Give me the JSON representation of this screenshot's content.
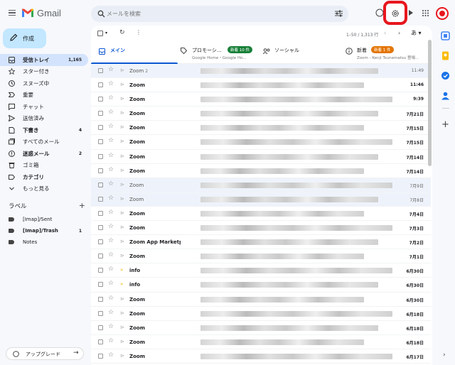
{
  "header": {
    "app": "Gmail",
    "search_placeholder": "メールを検索"
  },
  "compose": {
    "label": "作成"
  },
  "nav": [
    {
      "label": "受信トレイ",
      "count": "1,165",
      "active": true,
      "bold": true,
      "icon": "inbox-icon"
    },
    {
      "label": "スター付き",
      "count": "",
      "icon": "star-icon"
    },
    {
      "label": "スヌーズ中",
      "count": "",
      "icon": "clock-icon"
    },
    {
      "label": "重要",
      "count": "",
      "icon": "important-icon"
    },
    {
      "label": "チャット",
      "count": "",
      "icon": "chat-icon"
    },
    {
      "label": "送信済み",
      "count": "",
      "icon": "send-icon"
    },
    {
      "label": "下書き",
      "count": "4",
      "bold": true,
      "icon": "draft-icon"
    },
    {
      "label": "すべてのメール",
      "count": "",
      "icon": "all-mail-icon"
    },
    {
      "label": "迷惑メール",
      "count": "2",
      "bold": true,
      "icon": "spam-icon"
    },
    {
      "label": "ゴミ箱",
      "count": "",
      "icon": "trash-icon"
    },
    {
      "label": "カテゴリ",
      "count": "",
      "bold": true,
      "icon": "category-icon"
    },
    {
      "label": "もっと見る",
      "count": "",
      "icon": "chevron-down-icon"
    }
  ],
  "labels_title": "ラベル",
  "labels": [
    {
      "label": "[Imap]/Sent",
      "count": ""
    },
    {
      "label": "[Imap]/Trash",
      "count": "1",
      "bold": true
    },
    {
      "label": "Notes",
      "count": ""
    }
  ],
  "upgrade": "アップグレード",
  "toolbar": {
    "range": "1–50 / 1,313 行",
    "input_tool": "あ"
  },
  "tabs": [
    {
      "label": "メイン"
    },
    {
      "label": "プロモーシ...",
      "badge": "新着 10 件",
      "sub": "Google Home・Google Ho..."
    },
    {
      "label": "ソーシャル"
    },
    {
      "label": "新着",
      "badge": "新着 1 件",
      "sub": "Zoom - Kenji Tsunematsu 登場..."
    }
  ],
  "emails": [
    {
      "sender": "Zoom",
      "count": "2",
      "date": "11:49",
      "read": true,
      "w": 1
    },
    {
      "sender": "Zoom",
      "date": "11:46",
      "read": false,
      "w": 2
    },
    {
      "sender": "Zoom",
      "date": "9:39",
      "read": false,
      "w": 3
    },
    {
      "sender": "Zoom",
      "date": "7月21日",
      "read": false,
      "w": 1
    },
    {
      "sender": "Zoom",
      "date": "7月15日",
      "read": false,
      "w": 2
    },
    {
      "sender": "Zoom",
      "date": "7月15日",
      "read": false,
      "w": 3
    },
    {
      "sender": "Zoom",
      "date": "7月14日",
      "read": false,
      "w": 1
    },
    {
      "sender": "Zoom",
      "date": "7月14日",
      "read": false,
      "w": 2
    },
    {
      "sender": "Zoom",
      "date": "7月9日",
      "read": true,
      "w": 3
    },
    {
      "sender": "Zoom",
      "date": "7月8日",
      "read": true,
      "w": 1
    },
    {
      "sender": "Zoom",
      "date": "7月4日",
      "read": false,
      "w": 2
    },
    {
      "sender": "Zoom",
      "date": "7月3日",
      "read": false,
      "w": 3
    },
    {
      "sender": "Zoom App Marketpl",
      "date": "7月2日",
      "read": false,
      "w": 1
    },
    {
      "sender": "Zoom",
      "date": "7月1日",
      "read": false,
      "w": 2
    },
    {
      "sender": "info",
      "date": "6月30日",
      "read": false,
      "yellow": true,
      "w": 3
    },
    {
      "sender": "info",
      "date": "6月30日",
      "read": false,
      "yellow": true,
      "w": 1
    },
    {
      "sender": "Zoom",
      "date": "6月30日",
      "read": false,
      "w": 2
    },
    {
      "sender": "Zoom",
      "date": "6月18日",
      "read": false,
      "w": 3
    },
    {
      "sender": "Zoom",
      "date": "6月18日",
      "read": false,
      "w": 1
    },
    {
      "sender": "Zoom",
      "date": "6月18日",
      "read": false,
      "w": 2
    },
    {
      "sender": "Zoom",
      "date": "6月17日",
      "read": false,
      "w": 3
    }
  ],
  "colors": {
    "highlight": "#e8161d",
    "accent": "#0b57d0",
    "badge_green": "#188038",
    "badge_orange": "#e37400"
  }
}
